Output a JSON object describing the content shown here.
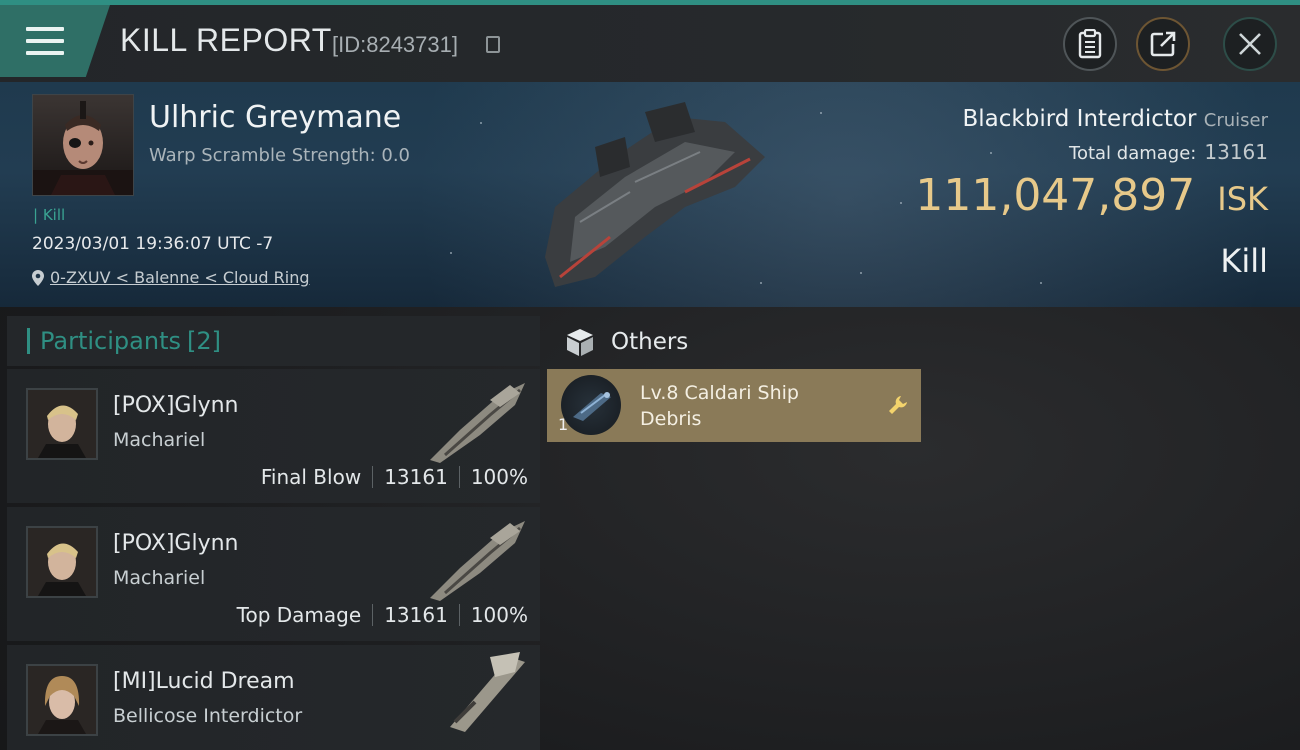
{
  "header": {
    "title": "KILL REPORT",
    "report_id": "[ID:8243731]",
    "icons": [
      "menu-icon",
      "copy-icon",
      "clipboard-icon",
      "share-icon",
      "close-icon"
    ]
  },
  "victim": {
    "name": "Ulhric Greymane",
    "warp_scramble": "Warp Scramble Strength: 0.0",
    "kill_tag": "| Kill",
    "datetime": "2023/03/01 19:36:07 UTC -7",
    "location": "0-ZXUV < Balenne < Cloud Ring",
    "ship_name": "Blackbird Interdictor",
    "ship_class": "Cruiser",
    "total_damage_label": "Total damage:",
    "total_damage": "13161",
    "isk_amount": "111,047,897",
    "isk_unit": "ISK",
    "result": "Kill"
  },
  "participants": {
    "label": "Participants",
    "count": "[2]",
    "rows": [
      {
        "name": "[POX]Glynn",
        "ship": "Machariel",
        "role": "Final Blow",
        "damage": "13161",
        "percent": "100%"
      },
      {
        "name": "[POX]Glynn",
        "ship": "Machariel",
        "role": "Top Damage",
        "damage": "13161",
        "percent": "100%"
      },
      {
        "name": "[MI]Lucid Dream",
        "ship": "Bellicose Interdictor",
        "role": "",
        "damage": "",
        "percent": ""
      }
    ]
  },
  "others": {
    "label": "Others",
    "items": [
      {
        "line1": "Lv.8 Caldari Ship",
        "line2": "Debris",
        "quantity": "1"
      }
    ]
  },
  "colors": {
    "accent_teal": "#2f8f83",
    "isk_gold": "#e7c98a",
    "loot_bg": "#8a7a58"
  }
}
